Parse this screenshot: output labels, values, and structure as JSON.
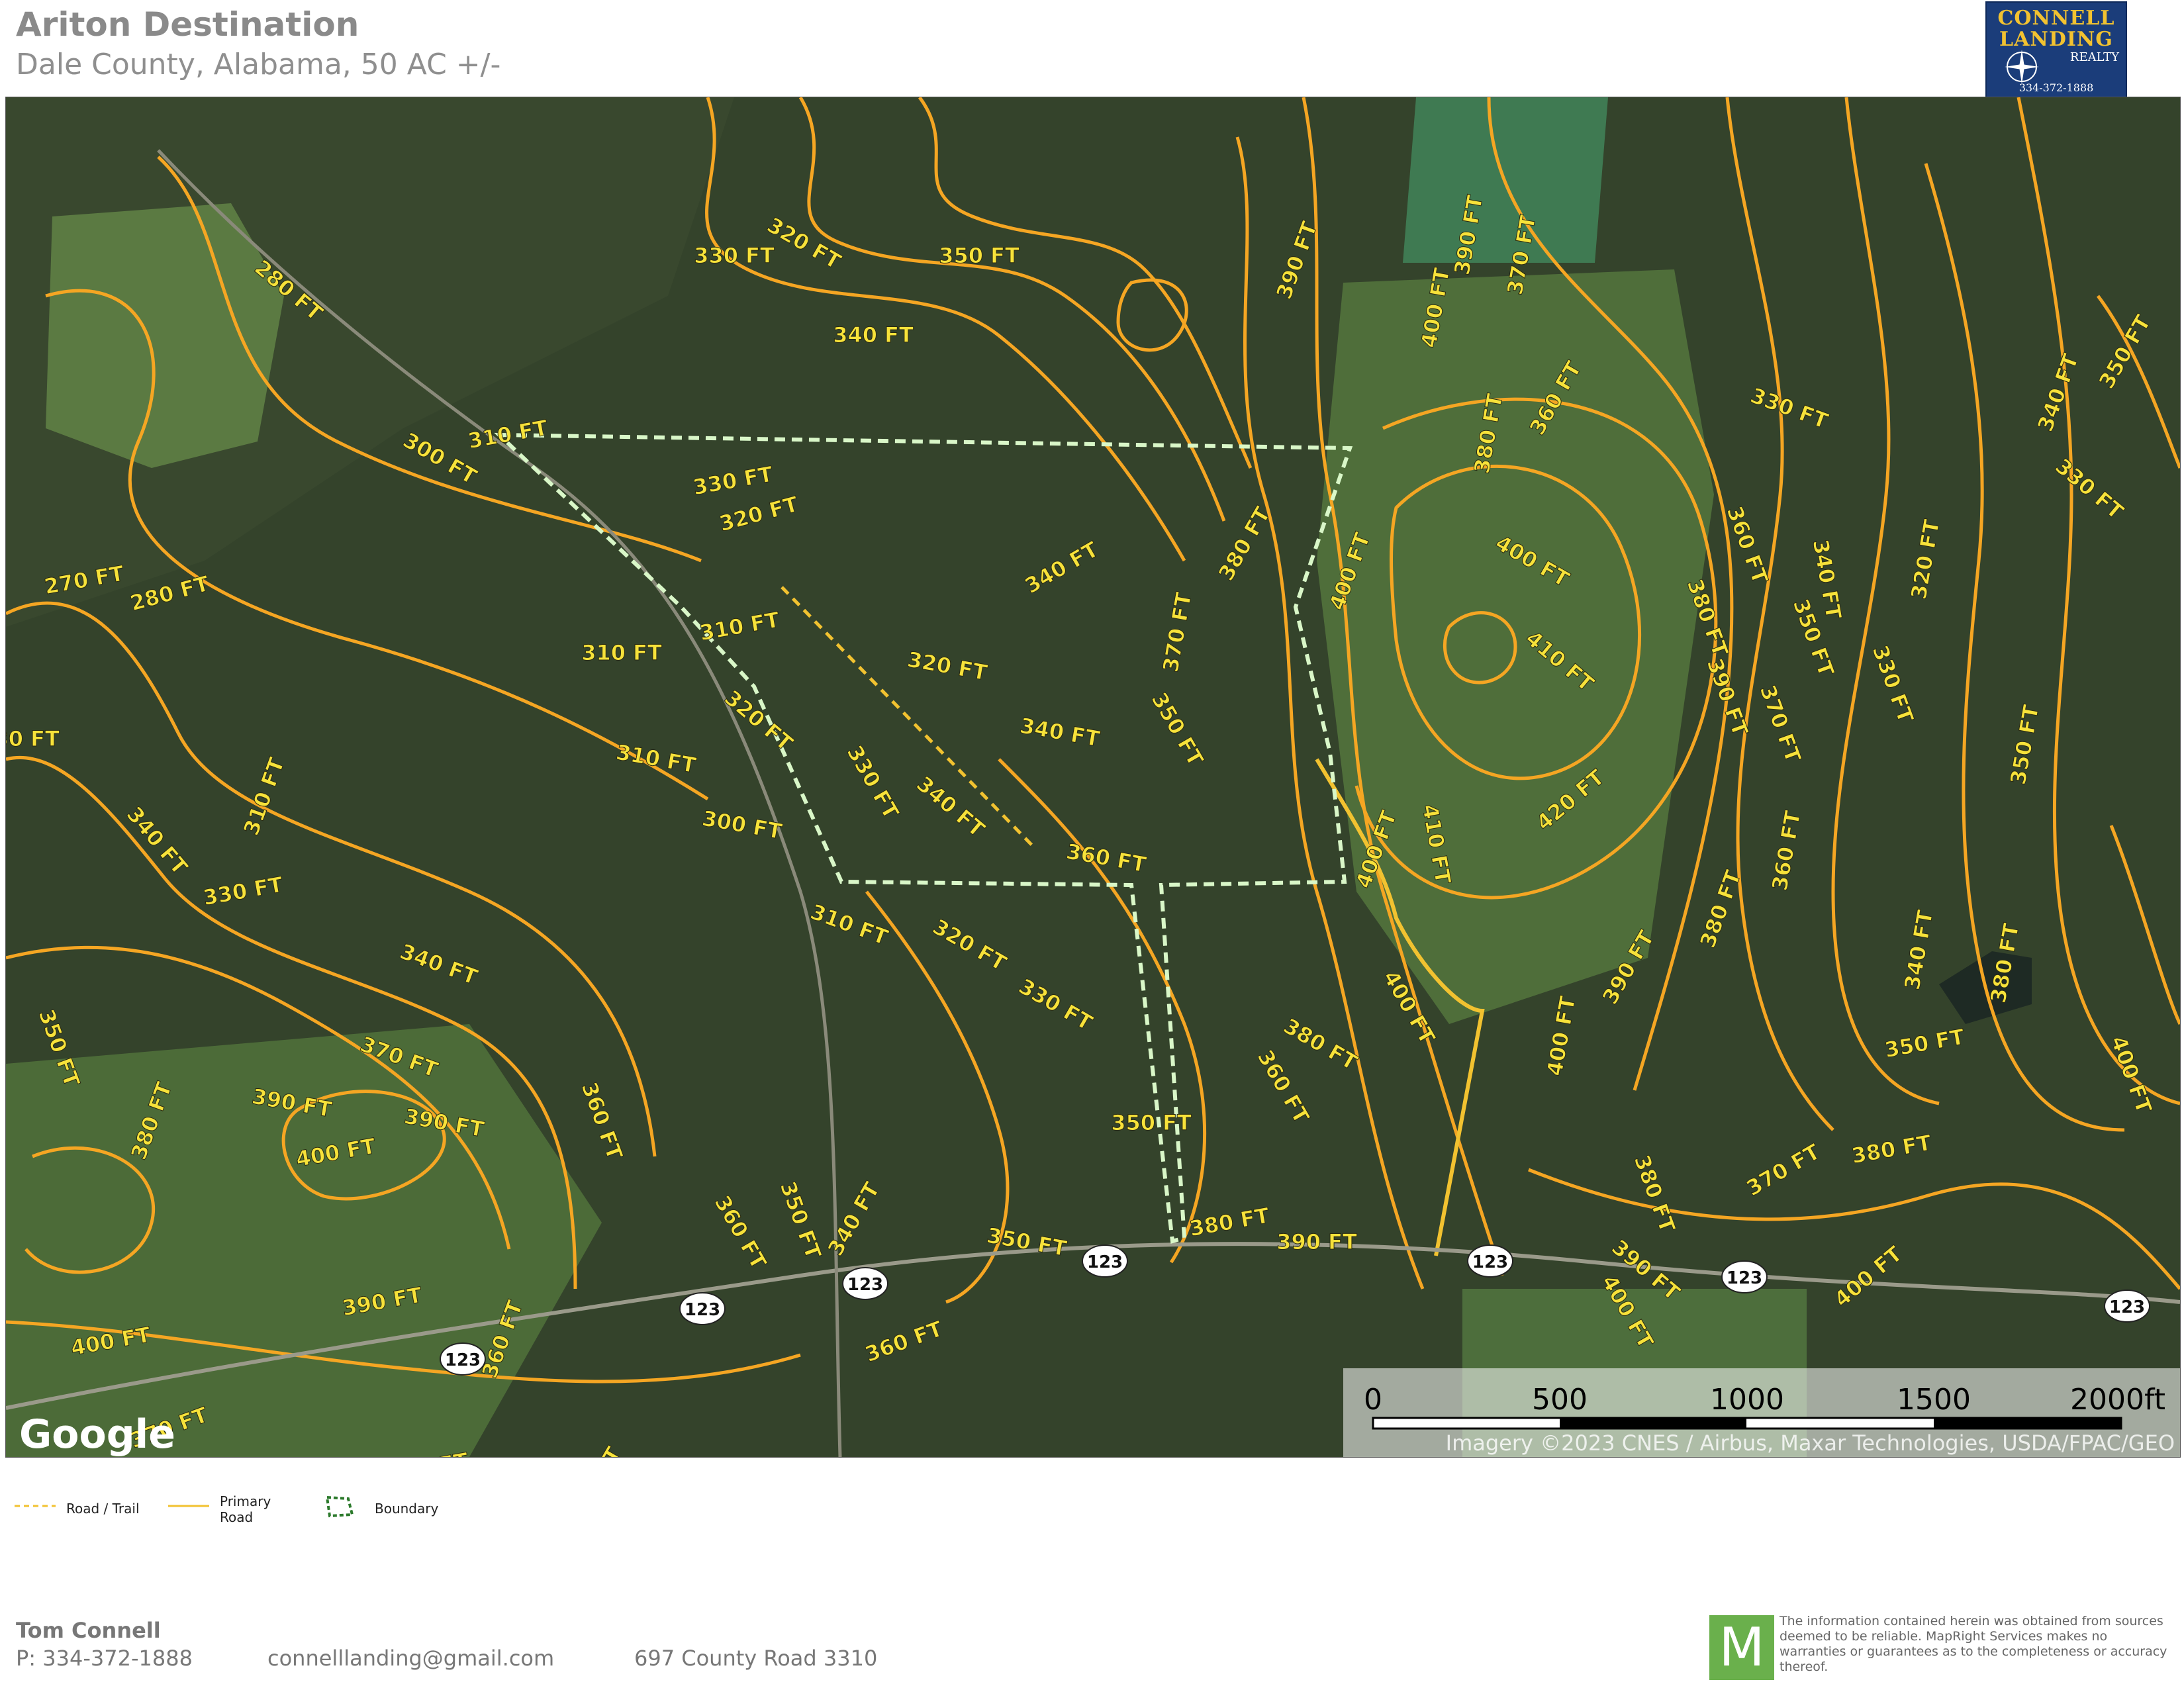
{
  "header": {
    "title": "Ariton Destination",
    "subtitle": "Dale County, Alabama, 50 AC +/-"
  },
  "logo": {
    "line1": "CONNELL",
    "line2": "LANDING",
    "line3": "REALTY",
    "phone": "334-372-1888",
    "icon": "compass-rose-icon"
  },
  "map": {
    "contour_labels": [
      "280 FT",
      "300 FT",
      "310 FT",
      "320 FT",
      "330 FT",
      "340 FT",
      "350 FT",
      "360 FT",
      "370 FT",
      "380 FT",
      "390 FT",
      "400 FT",
      "410 FT",
      "420 FT",
      "270 FT"
    ],
    "road_shields": [
      "123",
      "123",
      "123",
      "123",
      "123",
      "123",
      "123"
    ],
    "scale": {
      "ticks": [
        "0",
        "500",
        "1000",
        "1500",
        "2000ft"
      ]
    },
    "attribution": "Imagery ©2023 CNES / Airbus, Maxar Technologies, USDA/FPAC/GEO",
    "google_logo": "Google",
    "colors": {
      "contour": "#f5a623",
      "contour_label": "#f7e23a",
      "boundary": "#d9f7c8",
      "road_trail": "#f2c230",
      "primary_road": "#f2c230"
    }
  },
  "legend": {
    "items": [
      {
        "label": "Road / Trail",
        "icon": "dashed-line-icon"
      },
      {
        "label": "Primary Road",
        "icon": "solid-line-icon"
      },
      {
        "label": "Boundary",
        "icon": "boundary-polygon-icon"
      }
    ]
  },
  "footer": {
    "name": "Tom  Connell",
    "phone": "P: 334-372-1888",
    "email": "connelllanding@gmail.com",
    "address": "697 County Road 3310",
    "disclaimer": "The information contained herein was obtained from sources deemed to be reliable. MapRight Services makes no warranties or guarantees as to the completeness or accuracy thereof.",
    "badge_letter": "M"
  }
}
